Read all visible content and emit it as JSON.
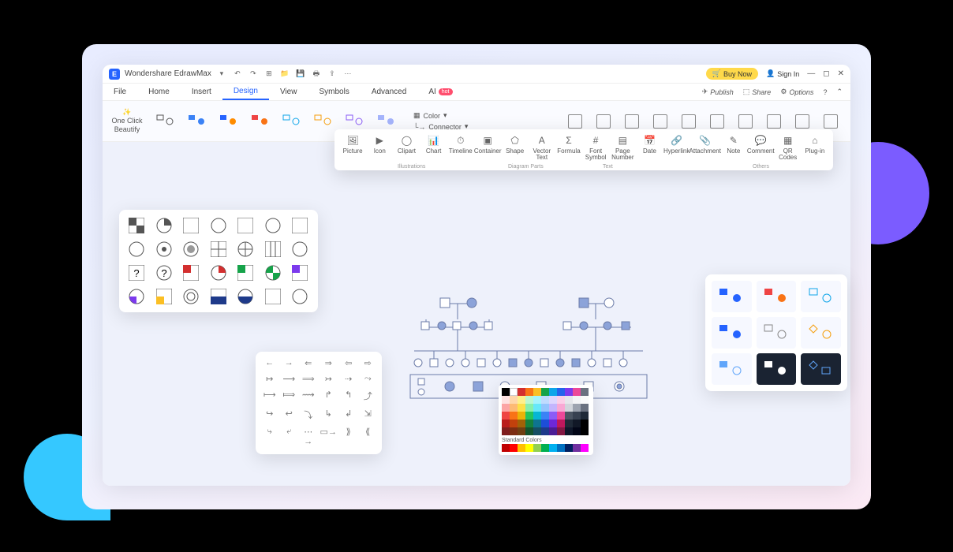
{
  "app_title": "Wondershare EdrawMax",
  "buy_now": "Buy Now",
  "sign_in": "Sign In",
  "menu": {
    "file": "File",
    "home": "Home",
    "insert": "Insert",
    "design": "Design",
    "view": "View",
    "symbols": "Symbols",
    "advanced": "Advanced",
    "ai": "AI",
    "hot": "hot"
  },
  "menu_right": {
    "publish": "Publish",
    "share": "Share",
    "options": "Options"
  },
  "one_click": "One Click Beautify",
  "props": {
    "color": "Color",
    "connector": "Connector"
  },
  "float": {
    "picture": "Picture",
    "icon": "Icon",
    "clipart": "Clipart",
    "chart": "Chart",
    "timeline": "Timeline",
    "container": "Container",
    "shape": "Shape",
    "vector": "Vector Text",
    "formula": "Formula",
    "font": "Font Symbol",
    "page": "Page Number",
    "date": "Date",
    "hyperlink": "Hyperlink",
    "attachment": "Attachment",
    "note": "Note",
    "comment": "Comment",
    "qr": "QR Codes",
    "plugin": "Plug-in"
  },
  "float_sections": {
    "illus": "Illustrations",
    "diag": "Diagram Parts",
    "text": "Text",
    "others": "Others"
  },
  "standard_colors": "Standard Colors"
}
